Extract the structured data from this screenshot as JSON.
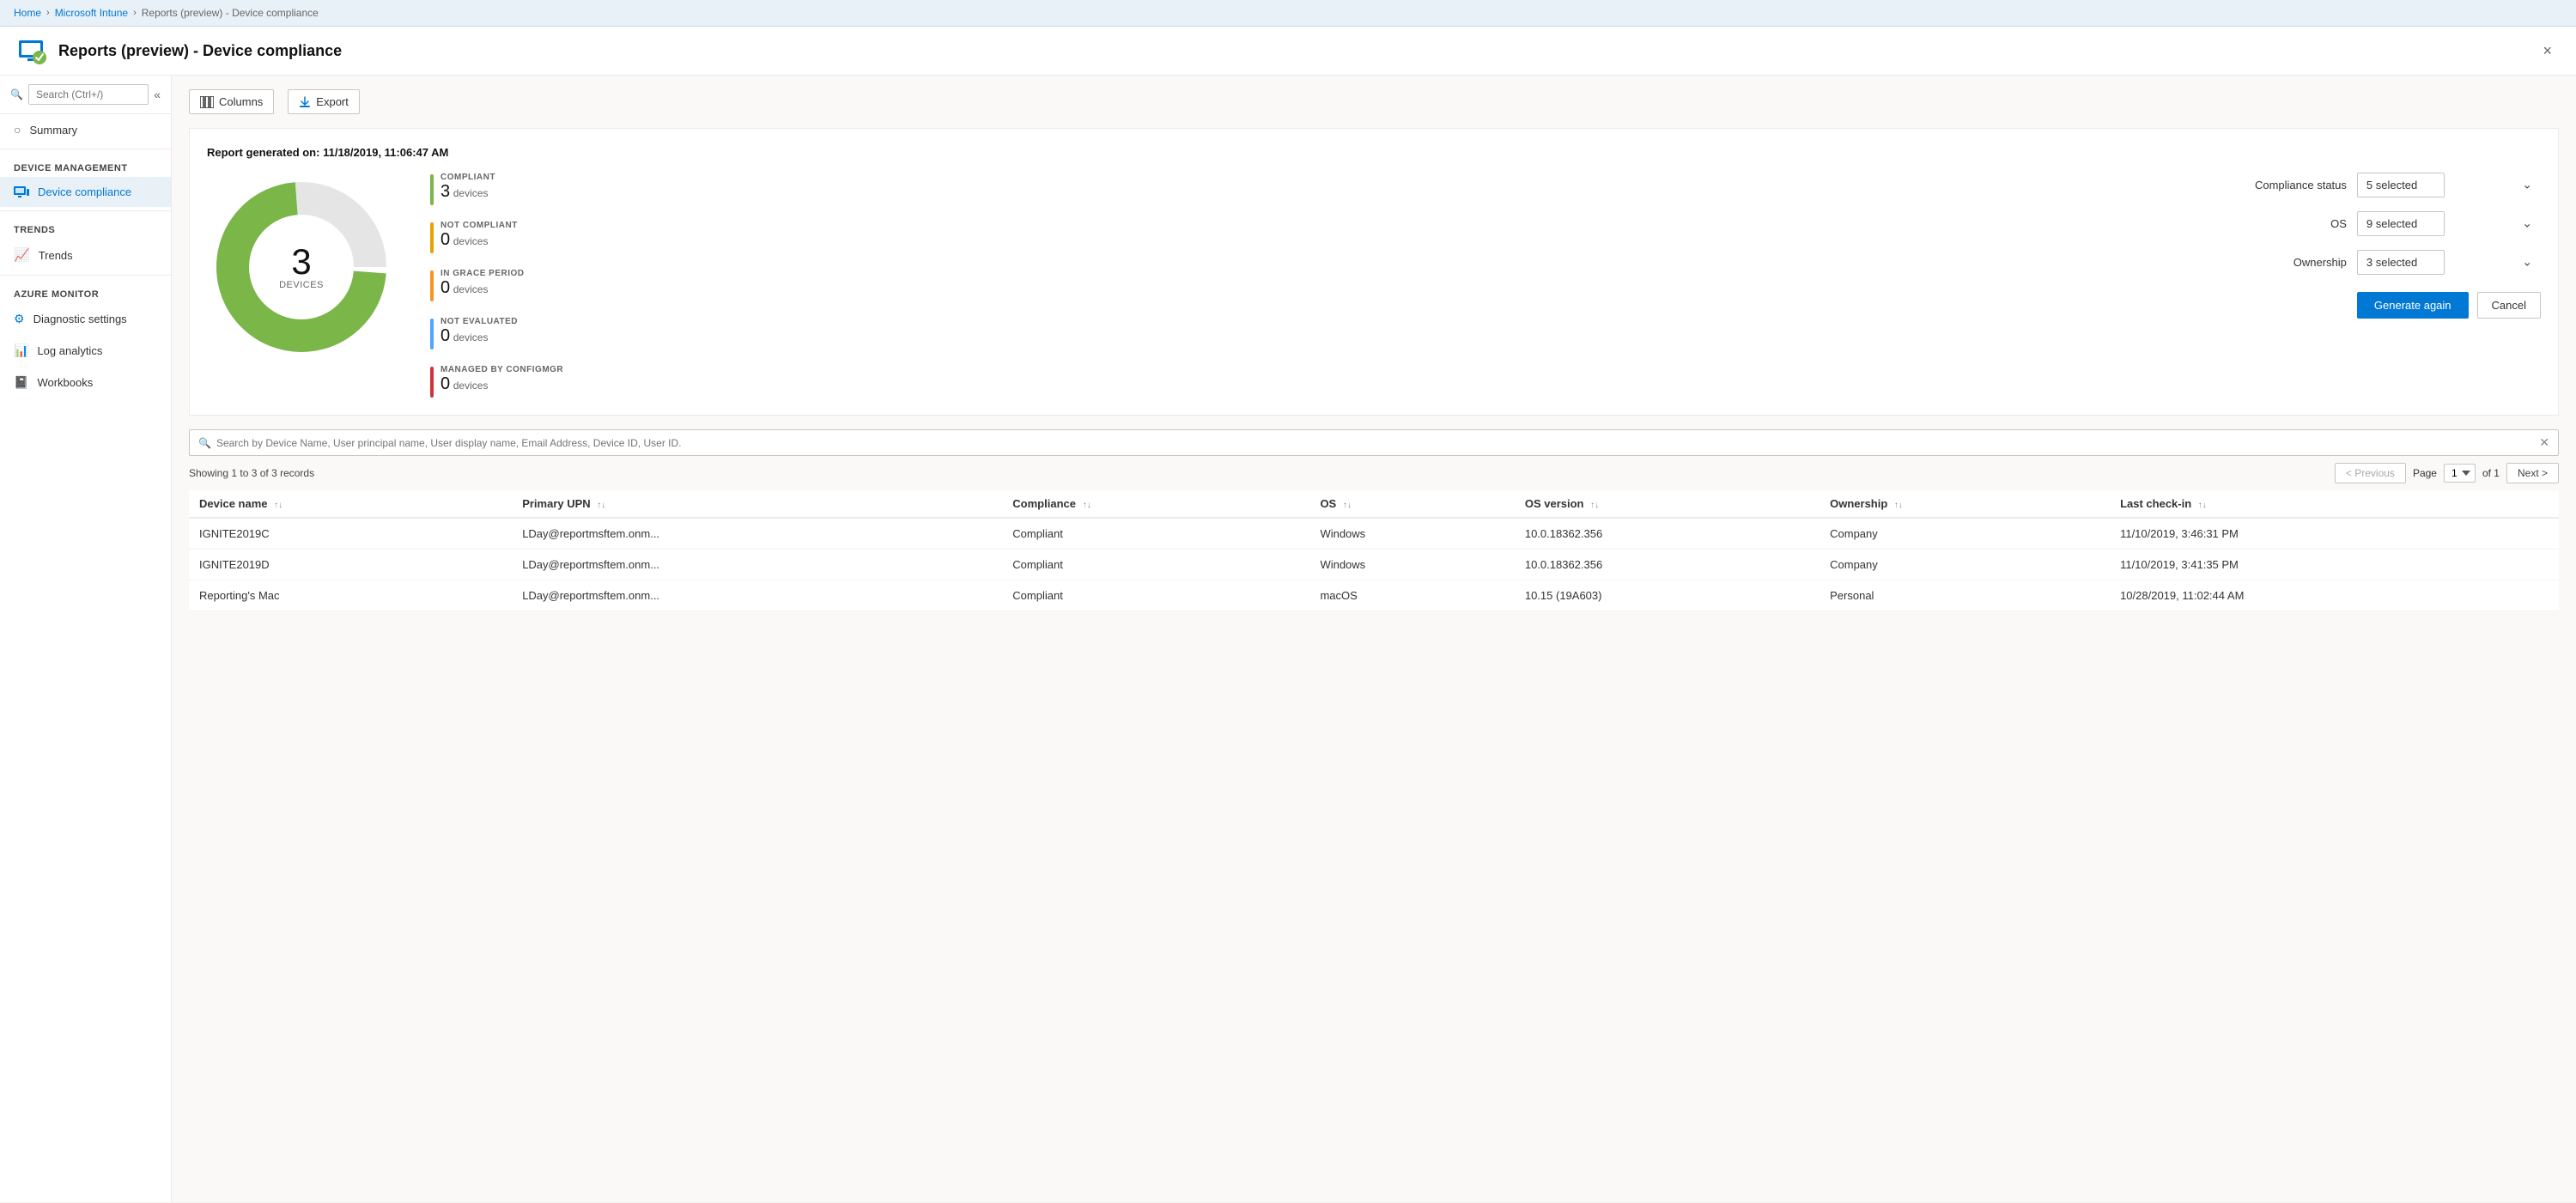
{
  "breadcrumb": {
    "home": "Home",
    "intune": "Microsoft Intune",
    "page": "Reports (preview) - Device compliance"
  },
  "titleBar": {
    "title": "Reports (preview) - Device compliance",
    "close_label": "×"
  },
  "sidebar": {
    "search_placeholder": "Search (Ctrl+/)",
    "collapse_icon": "«",
    "items": [
      {
        "id": "summary",
        "label": "Summary",
        "section": null,
        "active": false
      },
      {
        "id": "device-compliance",
        "label": "Device compliance",
        "section": "Device management",
        "active": true
      },
      {
        "id": "trends",
        "label": "Trends",
        "section": "Trends",
        "active": false
      },
      {
        "id": "diagnostic-settings",
        "label": "Diagnostic settings",
        "section": "Azure monitor",
        "active": false
      },
      {
        "id": "log-analytics",
        "label": "Log analytics",
        "section": null,
        "active": false
      },
      {
        "id": "workbooks",
        "label": "Workbooks",
        "section": null,
        "active": false
      }
    ]
  },
  "toolbar": {
    "columns_label": "Columns",
    "export_label": "Export"
  },
  "report": {
    "generated_label": "Report generated on:",
    "generated_date": "11/18/2019, 11:06:47 AM",
    "donut": {
      "total": "3",
      "unit": "DEVICES"
    },
    "stats": [
      {
        "id": "compliant",
        "label": "COMPLIANT",
        "value": "3",
        "unit": "devices",
        "color": "#7ab648"
      },
      {
        "id": "not-compliant",
        "label": "NOT COMPLIANT",
        "value": "0",
        "unit": "devices",
        "color": "#e8a200"
      },
      {
        "id": "grace-period",
        "label": "IN GRACE PERIOD",
        "value": "0",
        "unit": "devices",
        "color": "#f7941d"
      },
      {
        "id": "not-evaluated",
        "label": "NOT EVALUATED",
        "value": "0",
        "unit": "devices",
        "color": "#4da6ff"
      },
      {
        "id": "configmgr",
        "label": "MANAGED BY CONFIGMGR",
        "value": "0",
        "unit": "devices",
        "color": "#d13438"
      }
    ]
  },
  "filters": {
    "compliance_status_label": "Compliance status",
    "compliance_status_value": "5 selected",
    "os_label": "OS",
    "os_value": "9 selected",
    "ownership_label": "Ownership",
    "ownership_value": "3 selected",
    "generate_again_label": "Generate again",
    "cancel_label": "Cancel"
  },
  "search": {
    "placeholder": "Search by Device Name, User principal name, User display name, Email Address, Device ID, User ID."
  },
  "table": {
    "records_info": "Showing 1 to 3 of 3 records",
    "pagination": {
      "previous_label": "< Previous",
      "page_label": "Page",
      "current_page": "1",
      "total_pages_label": "of 1",
      "next_label": "Next >"
    },
    "columns": [
      {
        "id": "device-name",
        "label": "Device name"
      },
      {
        "id": "primary-upn",
        "label": "Primary UPN"
      },
      {
        "id": "compliance",
        "label": "Compliance"
      },
      {
        "id": "os",
        "label": "OS"
      },
      {
        "id": "os-version",
        "label": "OS version"
      },
      {
        "id": "ownership",
        "label": "Ownership"
      },
      {
        "id": "last-checkin",
        "label": "Last check-in"
      }
    ],
    "rows": [
      {
        "device_name": "IGNITE2019C",
        "primary_upn": "LDay@reportmsftem.onm...",
        "compliance": "Compliant",
        "os": "Windows",
        "os_version": "10.0.18362.356",
        "ownership": "Company",
        "last_checkin": "11/10/2019, 3:46:31 PM"
      },
      {
        "device_name": "IGNITE2019D",
        "primary_upn": "LDay@reportmsftem.onm...",
        "compliance": "Compliant",
        "os": "Windows",
        "os_version": "10.0.18362.356",
        "ownership": "Company",
        "last_checkin": "11/10/2019, 3:41:35 PM"
      },
      {
        "device_name": "Reporting's Mac",
        "primary_upn": "LDay@reportmsftem.onm...",
        "compliance": "Compliant",
        "os": "macOS",
        "os_version": "10.15 (19A603)",
        "ownership": "Personal",
        "last_checkin": "10/28/2019, 11:02:44 AM"
      }
    ]
  }
}
